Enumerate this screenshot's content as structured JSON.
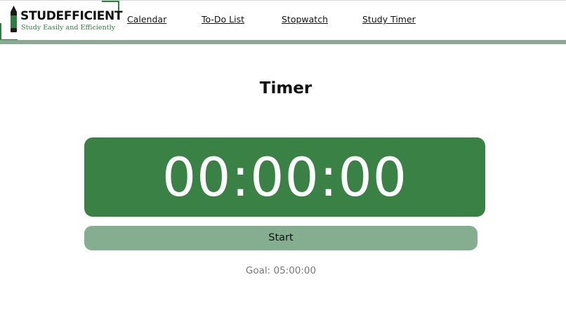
{
  "brand": {
    "name": "STUDEFFICIENT",
    "tagline": "Study Easily and Efficiently",
    "accent_color": "#2e7d43"
  },
  "nav": {
    "items": [
      {
        "label": "Calendar"
      },
      {
        "label": "To-Do List"
      },
      {
        "label": "Stopwatch"
      },
      {
        "label": "Study Timer"
      }
    ]
  },
  "main": {
    "title": "Timer",
    "timer": {
      "display": "00:00:00",
      "background_color": "#3a8146"
    },
    "start_button": {
      "label": "Start",
      "color": "#85ad90"
    },
    "goal": "Goal: 05:00:00"
  }
}
